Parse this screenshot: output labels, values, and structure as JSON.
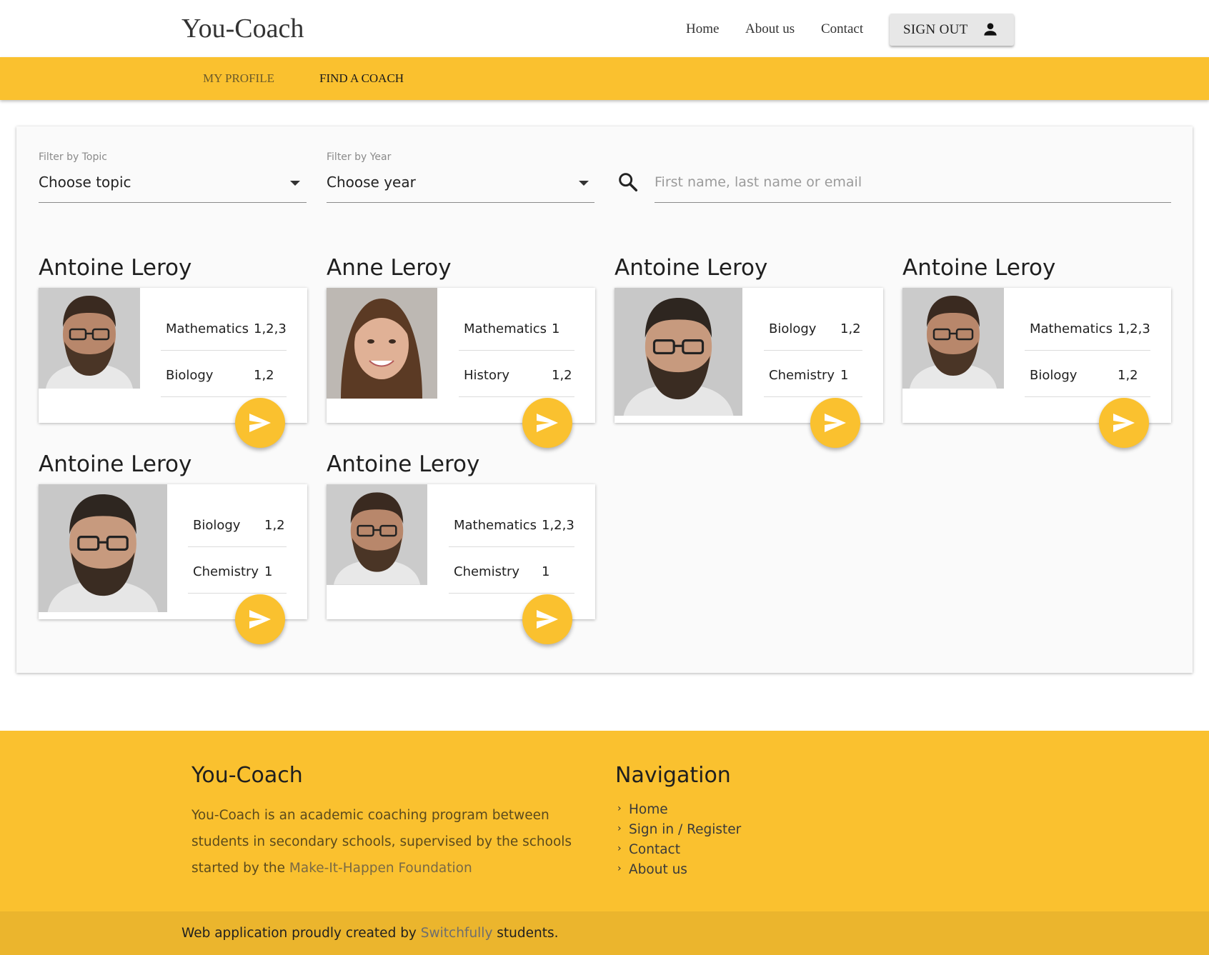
{
  "header": {
    "logo": "You-Coach",
    "nav": [
      "Home",
      "About us",
      "Contact"
    ],
    "signout_label": "SIGN OUT",
    "signout_icon": "person-icon"
  },
  "subnav": {
    "tabs": [
      "MY PROFILE",
      "FIND A COACH"
    ],
    "active_tab": "FIND A COACH"
  },
  "filters": {
    "topic_label": "Filter by Topic",
    "topic_value": "Choose topic",
    "year_label": "Filter by Year",
    "year_value": "Choose year",
    "search_placeholder": "First name, last name or email",
    "search_icon": "search-icon"
  },
  "coaches": [
    {
      "name": "Antoine Leroy",
      "topics": [
        {
          "topic": "Mathematics",
          "years": "1,2,3"
        },
        {
          "topic": "Biology",
          "years": "1,2"
        }
      ]
    },
    {
      "name": "Anne Leroy",
      "topics": [
        {
          "topic": "Mathematics",
          "years": "1"
        },
        {
          "topic": "History",
          "years": "1,2"
        }
      ]
    },
    {
      "name": "Antoine Leroy",
      "topics": [
        {
          "topic": "Biology",
          "years": "1,2"
        },
        {
          "topic": "Chemistry",
          "years": "1"
        }
      ]
    },
    {
      "name": "Antoine Leroy",
      "topics": [
        {
          "topic": "Mathematics",
          "years": "1,2,3"
        },
        {
          "topic": "Biology",
          "years": "1,2"
        }
      ]
    },
    {
      "name": "Antoine Leroy",
      "topics": [
        {
          "topic": "Biology",
          "years": "1,2"
        },
        {
          "topic": "Chemistry",
          "years": "1"
        }
      ]
    },
    {
      "name": "Antoine Leroy",
      "topics": [
        {
          "topic": "Mathematics",
          "years": "1,2,3"
        },
        {
          "topic": "Chemistry",
          "years": "1"
        }
      ]
    }
  ],
  "footer": {
    "title": "You-Coach",
    "desc_before": "You-Coach is an academic coaching program between students in secondary schools, supervised by the schools started by the ",
    "desc_link": "Make-It-Happen Foundation",
    "nav_title": "Navigation",
    "nav_links": [
      "Home",
      "Sign in / Register",
      "Contact",
      "About us"
    ],
    "credit_before": "Web application proudly created by ",
    "credit_brand": "Switchfully",
    "credit_after": " students."
  },
  "colors": {
    "accent": "#fac12f",
    "bottombar": "#ebb52d"
  }
}
